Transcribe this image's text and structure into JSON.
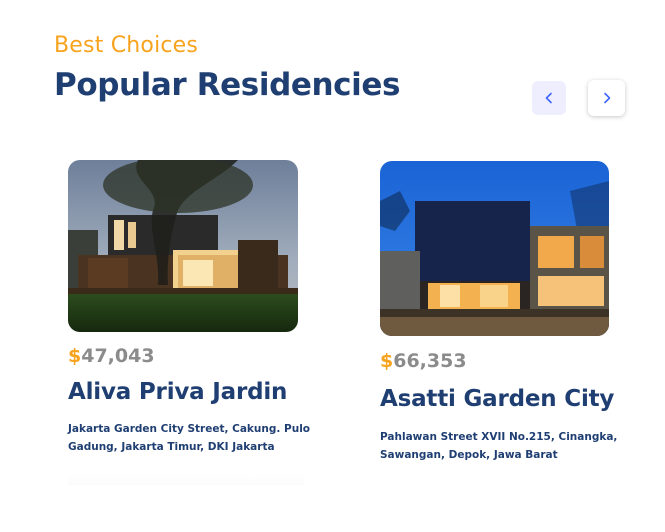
{
  "header": {
    "eyebrow": "Best Choices",
    "title": "Popular Residencies"
  },
  "nav": {
    "prev_icon": "chevron-left-icon",
    "next_icon": "chevron-right-icon"
  },
  "colors": {
    "accent": "#f7a31d",
    "primary": "#1f3e72",
    "price_gray": "#8c8b8b",
    "prev_bg": "#eeeeff",
    "chevron": "#4066ff"
  },
  "cards": [
    {
      "currency": "$",
      "price": "47,043",
      "name": "Aliva Priva Jardin",
      "address": "Jakarta Garden City Street, Cakung. Pulo Gadung, Jakarta Timur, DKI Jakarta"
    },
    {
      "currency": "$",
      "price": "66,353",
      "name": "Asatti Garden City",
      "address": "Pahlawan Street XVII No.215, Cinangka, Sawangan, Depok, Jawa Barat"
    }
  ]
}
